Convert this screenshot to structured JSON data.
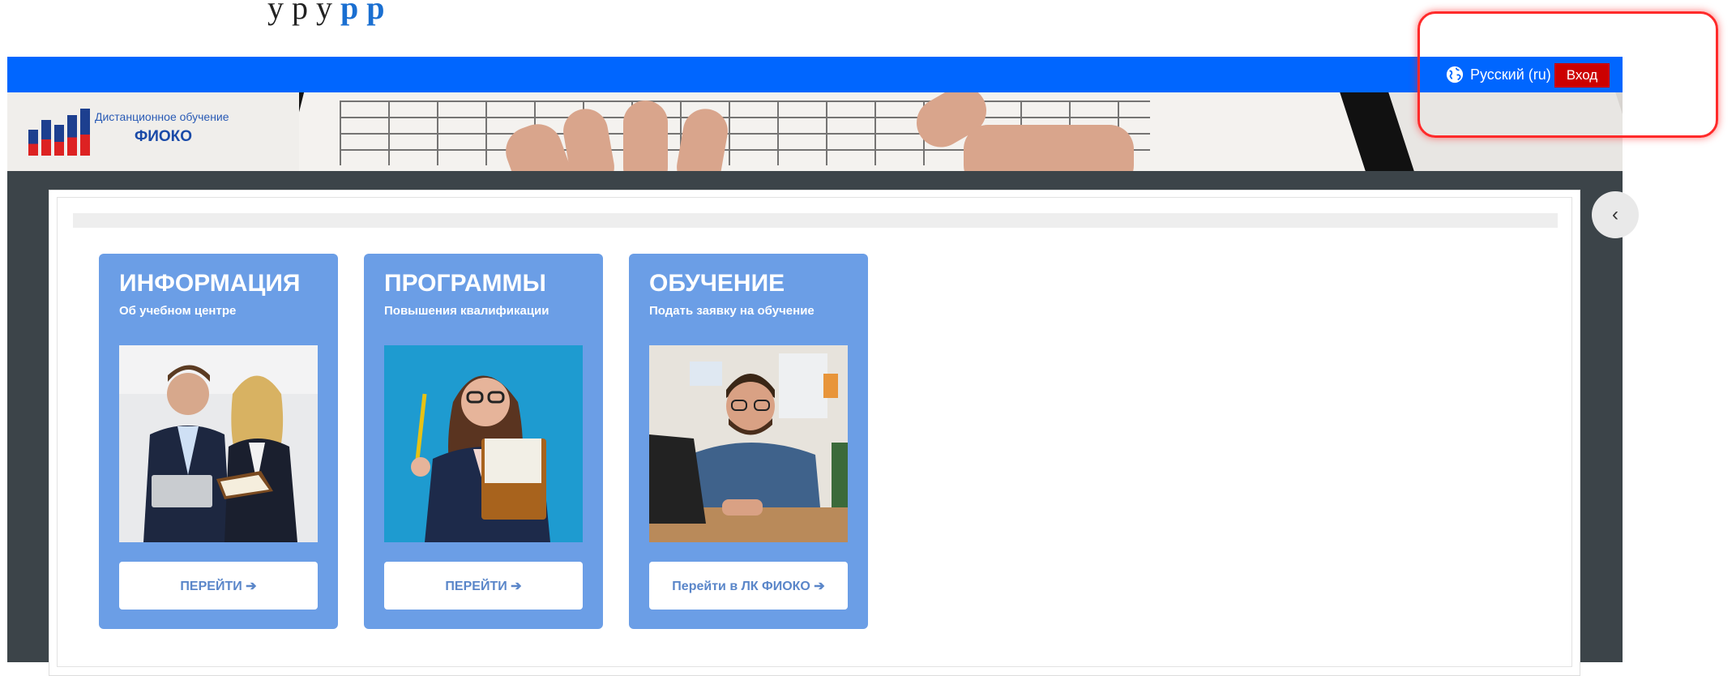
{
  "top_text": {
    "prefix": "у                                     р у",
    "link": "р  р"
  },
  "navbar": {
    "language_label": "Русский (ru)",
    "login_label": "Вход"
  },
  "banner": {
    "logo_line1": "Дистанционное обучение",
    "logo_line2": "ФИОКО"
  },
  "drawer_toggle": "‹",
  "cards": [
    {
      "title": "ИНФОРМАЦИЯ",
      "subtitle": "Об учебном центре",
      "button": "ПЕРЕЙТИ ➔"
    },
    {
      "title": "ПРОГРАММЫ",
      "subtitle": "Повышения квалификации",
      "button": "ПЕРЕЙТИ ➔"
    },
    {
      "title": "ОБУЧЕНИЕ",
      "subtitle": "Подать заявку на обучение",
      "button": "Перейти в ЛК ФИОКО ➔"
    }
  ],
  "colors": {
    "navbar": "#0066ff",
    "login_button": "#cc0000",
    "card": "#6b9ee6",
    "page_frame": "#3c4449",
    "highlight": "#ff2a2a"
  }
}
